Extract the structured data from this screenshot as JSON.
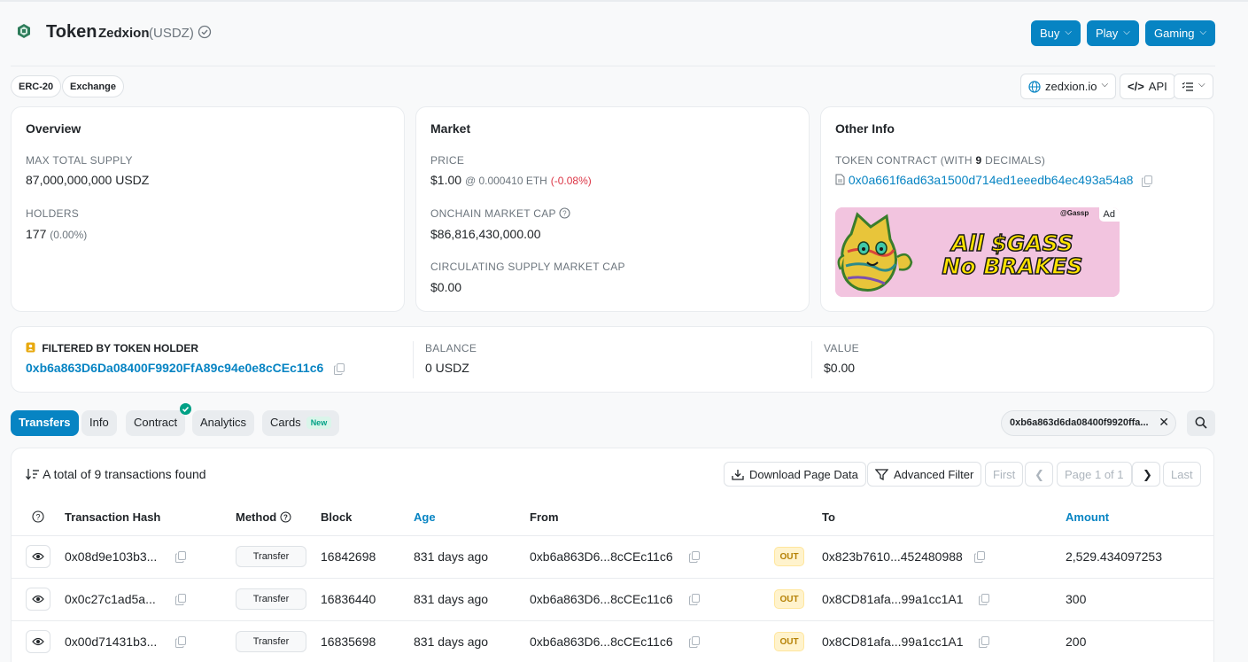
{
  "header": {
    "title": "Token",
    "token_name": "Zedxion",
    "token_symbol": "(USDZ)",
    "buttons": [
      {
        "label": "Buy"
      },
      {
        "label": "Play"
      },
      {
        "label": "Gaming"
      }
    ]
  },
  "tags": [
    "ERC-20",
    "Exchange"
  ],
  "site_links": {
    "website": "zedxion.io",
    "api": "API"
  },
  "overview": {
    "title": "Overview",
    "max_supply_label": "MAX TOTAL SUPPLY",
    "max_supply_value": "87,000,000,000 USDZ",
    "holders_label": "HOLDERS",
    "holders_value": "177",
    "holders_change": "(0.00%)"
  },
  "market": {
    "title": "Market",
    "price_label": "PRICE",
    "price_value": "$1.00",
    "price_eth": "@ 0.000410 ETH",
    "price_change": "(-0.08%)",
    "onchain_cap_label": "ONCHAIN MARKET CAP",
    "onchain_cap_value": "$86,816,430,000.00",
    "circ_cap_label": "CIRCULATING SUPPLY MARKET CAP",
    "circ_cap_value": "$0.00"
  },
  "other_info": {
    "title": "Other Info",
    "contract_label_prefix": "TOKEN CONTRACT (WITH ",
    "contract_decimals": "9",
    "contract_label_suffix": " DECIMALS)",
    "contract_address": "0x0a661f6ad63a1500d714ed1eeedb64ec493a54a8",
    "ad_tag": "Ad",
    "ad_line1": "All $GASS",
    "ad_line2": "No BRAKES",
    "ad_handle": "@Gassp"
  },
  "filter": {
    "label": "FILTERED BY TOKEN HOLDER",
    "address": "0xb6a863D6Da08400F9920FfA89c94e0e8cCEc11c6",
    "balance_label": "BALANCE",
    "balance_value": "0 USDZ",
    "value_label": "VALUE",
    "value_value": "$0.00"
  },
  "tabs": [
    {
      "label": "Transfers",
      "active": true
    },
    {
      "label": "Info"
    },
    {
      "label": "Contract"
    },
    {
      "label": "Analytics"
    },
    {
      "label": "Cards",
      "badge": "New"
    }
  ],
  "address_filter_chip": "0xb6a863d6da08400f9920ffa...",
  "table": {
    "summary": "A total of 9 transactions found",
    "download_label": "Download Page Data",
    "advanced_filter_label": "Advanced Filter",
    "pagination": {
      "first": "First",
      "page": "Page 1 of 1",
      "last": "Last"
    },
    "columns": [
      "Transaction Hash",
      "Method",
      "Block",
      "Age",
      "From",
      "To",
      "Amount"
    ],
    "rows": [
      {
        "hash": "0x08d9e103b3...",
        "method": "Transfer",
        "block": "16842698",
        "age": "831 days ago",
        "from": "0xb6a863D6...8cCEc11c6",
        "direction": "OUT",
        "to": "0x823b7610...452480988",
        "amount": "2,529.434097253"
      },
      {
        "hash": "0x0c27c1ad5a...",
        "method": "Transfer",
        "block": "16836440",
        "age": "831 days ago",
        "from": "0xb6a863D6...8cCEc11c6",
        "direction": "OUT",
        "to": "0x8CD81afa...99a1cc1A1",
        "amount": "300"
      },
      {
        "hash": "0x00d71431b3...",
        "method": "Transfer",
        "block": "16835698",
        "age": "831 days ago",
        "from": "0xb6a863D6...8cCEc11c6",
        "direction": "OUT",
        "to": "0x8CD81afa...99a1cc1A1",
        "amount": "200"
      }
    ]
  }
}
